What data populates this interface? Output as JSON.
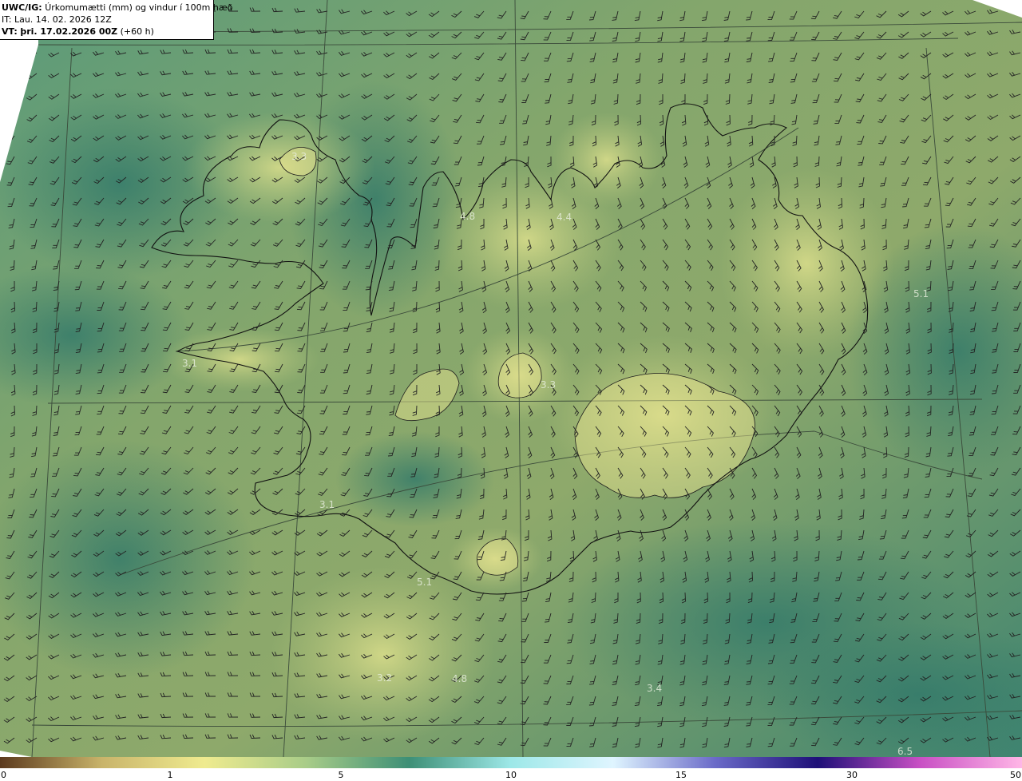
{
  "header": {
    "model": "UWC/IG:",
    "title": "Úrkomumætti (mm) og vindur í 100m hæð",
    "issue_time": "IT: Lau. 14. 02. 2026 12Z",
    "valid_prefix": "VT:",
    "valid_time_bold": "þri. 17.02.2026 00Z",
    "valid_offset": "(+60 h)"
  },
  "map_labels": [
    "3.3",
    "4.8",
    "4.4",
    "5.1",
    "3.1",
    "3.3",
    "3.1",
    "5.1",
    "3.2",
    "4.8",
    "3.4",
    "6.5"
  ],
  "legend": {
    "ticks": [
      "0",
      "1",
      "5",
      "10",
      "15",
      "30",
      "50"
    ],
    "colors": [
      "#5c3a1e",
      "#c9b46a",
      "#efeb8f",
      "#a8cc88",
      "#3d8f76",
      "#9de8e8",
      "#dff5ff",
      "#6a6ac8",
      "#1e0f78",
      "#c84fc4",
      "#ffb6e6"
    ]
  },
  "colors": {
    "map_base": "#6f9a6a",
    "land_light": "#d8dc8a",
    "sea_dark": "#3d7a68",
    "outside": "#ffffff",
    "coast": "#1d1d1d",
    "barb": "#2a2a2a"
  }
}
